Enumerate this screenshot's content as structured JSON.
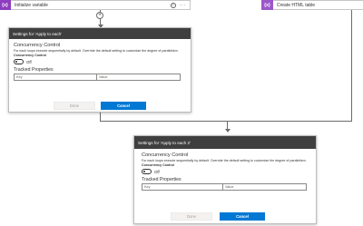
{
  "actions": {
    "initialize_variable": {
      "title": "Initialize variable",
      "icon_name": "variable-icon",
      "icon_glyph": "{x}",
      "color": "#8e3dbe"
    },
    "create_html_table": {
      "title": "Create HTML table",
      "icon_name": "data-operation-icon",
      "icon_glyph": "{x}",
      "color": "#9b57c9"
    },
    "help_glyph": "?",
    "more_glyph": "···"
  },
  "connectors": {
    "add_glyph": "+"
  },
  "panel1": {
    "header": "Settings for 'Apply to each'",
    "concurrency_title": "Concurrency Control",
    "concurrency_desc": "For each loops execute sequentially by default. Override the default setting to customize the degree of parallelism.",
    "concurrency_label": "Concurrency Control",
    "toggle_state": "Off",
    "tracked_title": "Tracked Properties",
    "key_placeholder": "Key",
    "value_placeholder": "Value",
    "done_label": "Done",
    "cancel_label": "Cancel"
  },
  "panel2": {
    "header": "Settings for 'Apply to each 2'",
    "concurrency_title": "Concurrency Control",
    "concurrency_desc": "For each loops execute sequentially by default. Override the default setting to customize the degree of parallelism.",
    "concurrency_label": "Concurrency Control",
    "toggle_state": "Off",
    "tracked_title": "Tracked Properties",
    "key_placeholder": "Key",
    "value_placeholder": "Value",
    "done_label": "Done",
    "cancel_label": "Cancel"
  },
  "colors": {
    "accent": "#0078d4",
    "header_bg": "#3f3f3f",
    "connector": "#6b6b6b"
  }
}
